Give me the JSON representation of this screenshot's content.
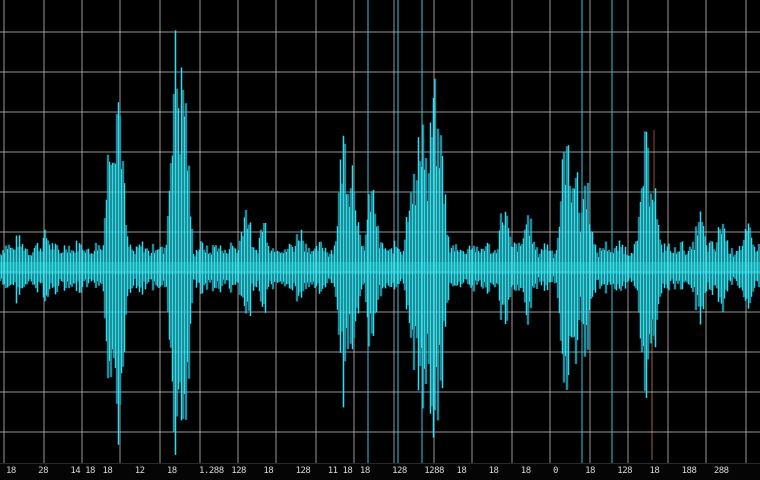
{
  "image": {
    "kind": "oscilloscope-style audio waveform on a grid",
    "colors": {
      "background": "#000000",
      "grid": "#c8c8c8",
      "grid_accent": "#2fc3d6",
      "waveform": "#35e6ee",
      "waveform_glow": "#1aa6d9"
    }
  },
  "scale_labels": [
    "18",
    "28",
    "14 18",
    "18",
    "12",
    "18",
    "1.288",
    "128",
    "18",
    "128",
    "11 18",
    "18",
    "128",
    "1288",
    "18",
    "18",
    "18",
    "0",
    "18",
    "128",
    "18",
    "188",
    "288"
  ]
}
